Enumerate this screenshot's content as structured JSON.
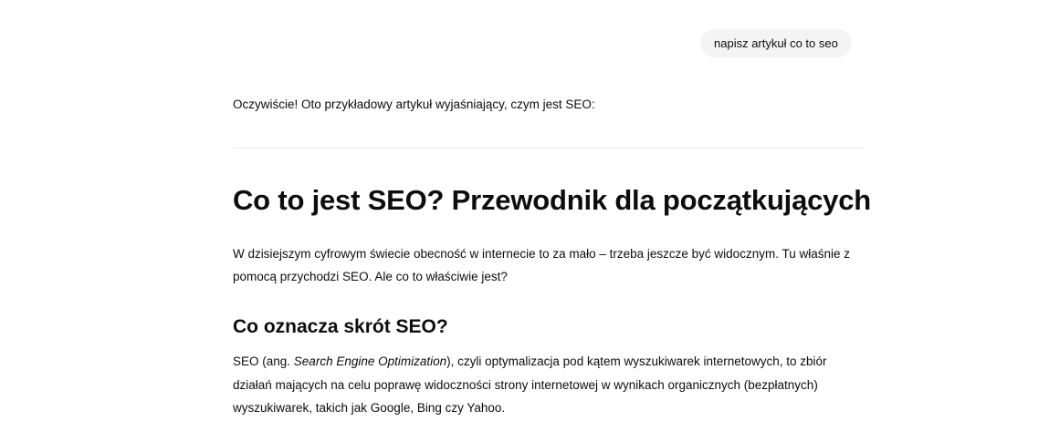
{
  "user_message": {
    "text": "napisz artykuł co to seo"
  },
  "assistant_message": {
    "intro": "Oczywiście! Oto przykładowy artykuł wyjaśniający, czym jest SEO:",
    "article": {
      "title": "Co to jest SEO? Przewodnik dla początkujących",
      "paragraph1": "W dzisiejszym cyfrowym świecie obecność w internecie to za mało – trzeba jeszcze być widocznym. Tu właśnie z pomocą przychodzi SEO. Ale co to właściwie jest?",
      "section1_heading": "Co oznacza skrót SEO?",
      "section1_paragraph": {
        "before": "SEO (ang. ",
        "emphasis": "Search Engine Optimization",
        "after": "), czyli optymalizacja pod kątem wyszukiwarek internetowych, to zbiór działań mających na celu poprawę widoczności strony internetowej w wynikach organicznych (bezpłatnych) wyszukiwarek, takich jak Google, Bing czy Yahoo."
      }
    }
  }
}
